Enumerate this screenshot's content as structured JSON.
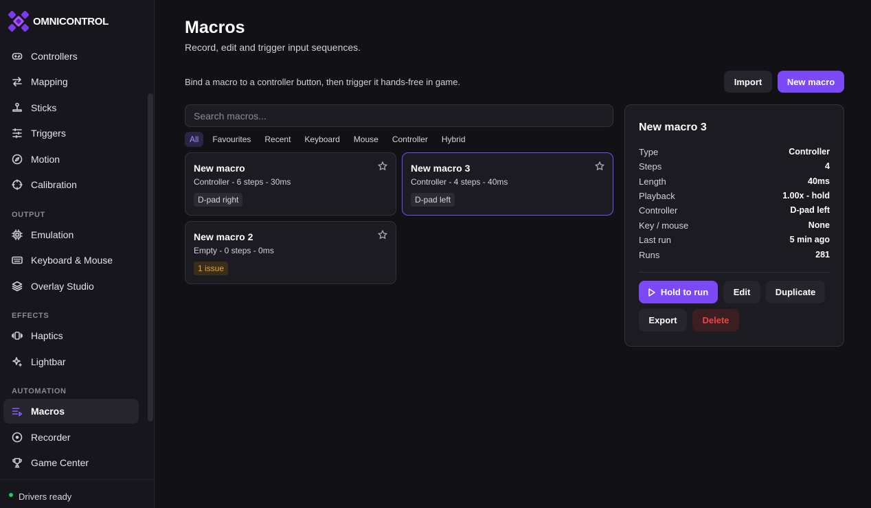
{
  "app": {
    "name_bold": "OMNI",
    "name_rest": "CONTROL"
  },
  "sidebar": {
    "items_top": [
      {
        "label": "Controllers",
        "icon": "gamepad-icon"
      },
      {
        "label": "Mapping",
        "icon": "swap-arrows-icon"
      },
      {
        "label": "Sticks",
        "icon": "joystick-icon"
      },
      {
        "label": "Triggers",
        "icon": "sliders-icon"
      },
      {
        "label": "Motion",
        "icon": "compass-icon"
      },
      {
        "label": "Calibration",
        "icon": "crosshair-icon"
      }
    ],
    "section_output": "OUTPUT",
    "items_output": [
      {
        "label": "Emulation",
        "icon": "chip-icon"
      },
      {
        "label": "Keyboard & Mouse",
        "icon": "keyboard-icon"
      },
      {
        "label": "Overlay Studio",
        "icon": "layers-icon"
      }
    ],
    "section_effects": "EFFECTS",
    "items_effects": [
      {
        "label": "Haptics",
        "icon": "vibrate-icon"
      },
      {
        "label": "Lightbar",
        "icon": "sparkle-icon"
      }
    ],
    "section_automation": "AUTOMATION",
    "items_automation": [
      {
        "label": "Macros",
        "icon": "macro-list-icon",
        "active": true
      },
      {
        "label": "Recorder",
        "icon": "record-icon"
      },
      {
        "label": "Game Center",
        "icon": "trophy-icon"
      }
    ],
    "footer_status": "Drivers ready",
    "status_color": "#22c55e"
  },
  "main": {
    "title": "Macros",
    "subtitle": "Record, edit and trigger input sequences.",
    "hint": "Bind a macro to a controller button, then trigger it hands-free in game.",
    "import_label": "Import",
    "new_macro_label": "New macro",
    "search_placeholder": "Search macros...",
    "filters": [
      "All",
      "Favourites",
      "Recent",
      "Keyboard",
      "Mouse",
      "Controller",
      "Hybrid"
    ],
    "active_filter": "All",
    "cards": [
      {
        "title": "New macro",
        "meta": "Controller - 6 steps - 30ms",
        "tag": "D-pad right",
        "warn": false
      },
      {
        "title": "New macro 3",
        "meta": "Controller - 4 steps - 40ms",
        "tag": "D-pad left",
        "warn": false,
        "selected": true
      },
      {
        "title": "New macro 2",
        "meta": "Empty - 0 steps - 0ms",
        "tag": "1 issue",
        "warn": true
      }
    ]
  },
  "detail": {
    "title": "New macro 3",
    "rows": [
      {
        "k": "Type",
        "v": "Controller"
      },
      {
        "k": "Steps",
        "v": "4"
      },
      {
        "k": "Length",
        "v": "40ms"
      },
      {
        "k": "Playback",
        "v": "1.00x - hold"
      },
      {
        "k": "Controller",
        "v": "D-pad left"
      },
      {
        "k": "Key / mouse",
        "v": "None"
      },
      {
        "k": "Last run",
        "v": "5 min ago"
      },
      {
        "k": "Runs",
        "v": "281"
      }
    ],
    "run_label": "Hold to run",
    "edit_label": "Edit",
    "duplicate_label": "Duplicate",
    "export_label": "Export",
    "delete_label": "Delete"
  },
  "colors": {
    "accent": "#7b49f5",
    "danger": "#ef4444",
    "warn": "#e6a23c"
  }
}
